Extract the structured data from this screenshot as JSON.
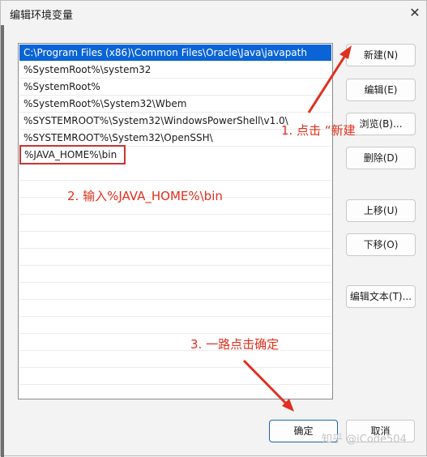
{
  "window": {
    "title": "编辑环境变量",
    "close_glyph": "✕"
  },
  "paths": [
    "C:\\Program Files (x86)\\Common Files\\Oracle\\Java\\javapath",
    "%SystemRoot%\\system32",
    "%SystemRoot%",
    "%SystemRoot%\\System32\\Wbem",
    "%SYSTEMROOT%\\System32\\WindowsPowerShell\\v1.0\\",
    "%SYSTEMROOT%\\System32\\OpenSSH\\",
    "%JAVA_HOME%\\bin"
  ],
  "buttons": {
    "new": "新建(N)",
    "edit": "编辑(E)",
    "browse": "浏览(B)...",
    "delete": "删除(D)",
    "move_up": "上移(U)",
    "move_down": "下移(O)",
    "edit_text": "编辑文本(T)...",
    "ok": "确定",
    "cancel": "取消"
  },
  "annotations": {
    "step1": "1. 点击 “新建",
    "step2": "2. 输入%JAVA_HOME%\\bin",
    "step3": "3. 一路点击确定"
  },
  "watermark": "知乎 @iCode504",
  "colors": {
    "annotation": "#e0301e",
    "selection": "#0a64d6"
  }
}
